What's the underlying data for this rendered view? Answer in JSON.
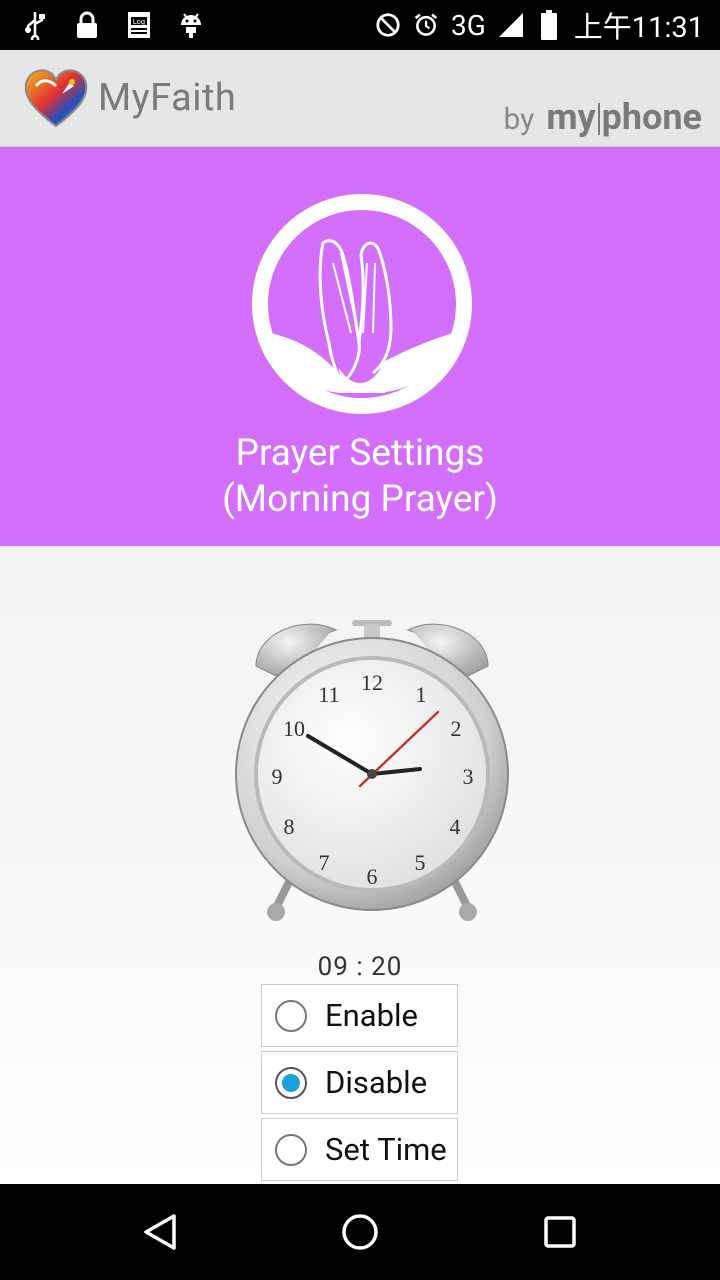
{
  "status_bar": {
    "time": "上午11:31",
    "network": "3G"
  },
  "app_bar": {
    "title": "MyFaith",
    "brand_by": "by",
    "brand_my": "my",
    "brand_phone": "phone"
  },
  "hero": {
    "title_line1": "Prayer Settings",
    "title_line2": "(Morning Prayer)"
  },
  "clock": {
    "time_label": "09 : 20",
    "numerals": [
      "12",
      "1",
      "2",
      "3",
      "4",
      "5",
      "6",
      "7",
      "8",
      "9",
      "10",
      "11"
    ]
  },
  "options": {
    "enable_label": "Enable",
    "disable_label": "Disable",
    "set_time_label": "Set Time",
    "selected": "Disable"
  },
  "colors": {
    "hero_bg": "#d46ffc",
    "radio_accent": "#1ba0d8"
  }
}
